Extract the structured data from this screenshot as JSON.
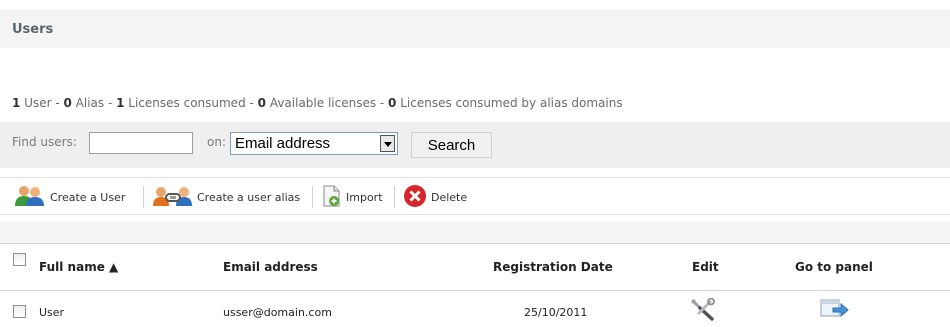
{
  "header": {
    "title": "Users"
  },
  "summary": {
    "user_count": "1",
    "user_label": " User - ",
    "alias_count": "0",
    "alias_label": " Alias - ",
    "licenses_consumed_count": "1",
    "licenses_consumed_label": " Licenses consumed - ",
    "available_licenses_count": "0",
    "available_licenses_label": " Available licenses - ",
    "alias_domain_licenses_count": "0",
    "alias_domain_licenses_label": " Licenses consumed by alias domains"
  },
  "search": {
    "find_label": "Find users:",
    "input_value": "",
    "on_label": "on:",
    "select_value": "Email address",
    "button_label": "Search"
  },
  "toolbar": {
    "create_user_label": "Create a User",
    "create_alias_label": "Create a user alias",
    "import_label": "Import",
    "delete_label": "Delete"
  },
  "table": {
    "columns": {
      "full_name": "Full name ▲",
      "email": "Email address",
      "registration_date": "Registration Date",
      "edit": "Edit",
      "go_to_panel": "Go to panel"
    },
    "rows": [
      {
        "full_name": "User",
        "email": "usser@domain.com",
        "registration_date": "25/10/2011"
      }
    ]
  },
  "icons": {
    "create_user": "users-icon",
    "create_alias": "user-alias-icon",
    "import": "import-icon",
    "delete": "delete-icon",
    "edit": "wrench-icon",
    "go_to_panel": "panel-arrow-icon"
  },
  "colors": {
    "delete_red": "#d7262b",
    "user_green": "#3c9b3a",
    "user_blue": "#2f6fbf",
    "panel_blue": "#4a90d9"
  }
}
